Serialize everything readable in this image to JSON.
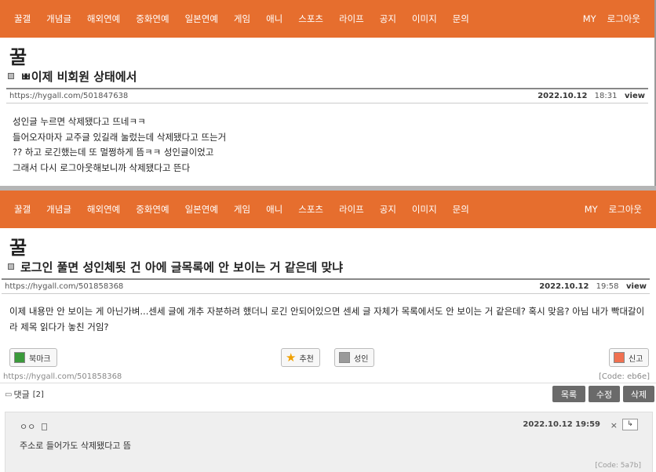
{
  "nav": {
    "items": [
      "꿀갤",
      "개념글",
      "해외연예",
      "중화연예",
      "일본연예",
      "게임",
      "애니",
      "스포츠",
      "라이프",
      "공지",
      "이미지",
      "문의"
    ],
    "right": [
      "MY",
      "로그아웃"
    ]
  },
  "post1": {
    "board": "꿀",
    "title": "ㅃ이제 비회원 상태에서",
    "url": "https://hygall.com/501847638",
    "date": "2022.10.12",
    "time": "18:31",
    "view": "view",
    "lines": [
      "성인글 누르면 삭제됐다고 뜨네ㅋㅋ",
      "들어오자마자 교주글 있길래 눌렀는데 삭제됐다고 뜨는거",
      "?? 하고 로긴했는데 또 멀쩡하게 뜸ㅋㅋ 성인글이었고",
      "그래서 다시 로그아웃해보니까 삭제됐다고 뜬다"
    ]
  },
  "post2": {
    "board": "꿀",
    "title": "로그인 풀면 성인체됫 건 아에 글목록에 안 보이는 거 같은데 맞냐",
    "url": "https://hygall.com/501858368",
    "date": "2022.10.12",
    "time": "19:58",
    "view": "view",
    "lines": [
      "이제 내용만 안 보이는 게 아닌가벼...센세 글에 개추 자분하려 했더니 로긴 안되어있으면 센세 글 자체가 목록에서도 안 보이는 거 같은데? 혹시 맞음? 아님 내가 빡대갈이라 제목 읽다가 놓친 거임?"
    ],
    "buttons": {
      "bookmark": "북마크",
      "recommend": "추천",
      "adult": "성인",
      "report": "신고"
    },
    "footer_url": "https://hygall.com/501858368",
    "code": "[Code: eb6e]",
    "comments_label": "댓글",
    "comments_count": "[2]",
    "actions": {
      "list": "목록",
      "edit": "수정",
      "delete": "삭제"
    },
    "comment": {
      "author": "ㅇㅇ",
      "date": "2022.10.12 19:59",
      "close": "×",
      "reply": "↳",
      "text": "주소로 들어가도 삭제됐다고 뜸",
      "code": "[Code: 5a7b]"
    }
  },
  "colors": {
    "nav": "#e66e2e",
    "bookmark": "#3a9a3a",
    "adult": "#9a9a9a",
    "report": "#f07050"
  }
}
